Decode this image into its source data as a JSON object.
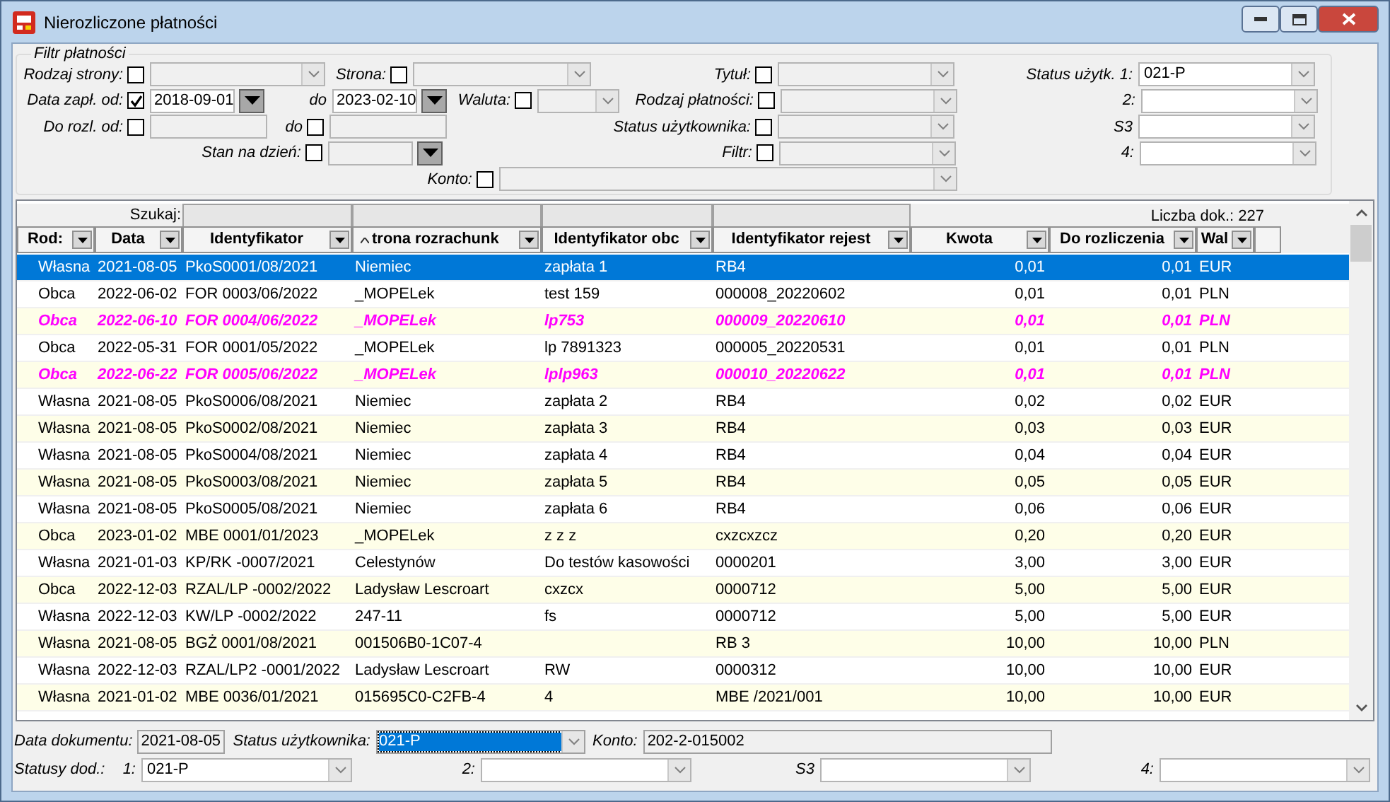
{
  "window": {
    "title": "Nierozliczone płatności"
  },
  "filter": {
    "title": "Filtr płatności",
    "fields": [
      {
        "label": "Rodzaj strony:",
        "kind": "combo",
        "checked": false
      },
      {
        "label": "Strona:",
        "kind": "combo",
        "checked": false
      },
      {
        "label": "Tytuł:",
        "kind": "combo",
        "checked": false
      },
      {
        "label": "Status użytk. 1:",
        "kind": "combo",
        "value": "021-P"
      },
      {
        "label": "Data zapł. od:",
        "kind": "date",
        "checked": true,
        "value": "2018-09-01"
      },
      {
        "label": "do",
        "kind": "date",
        "value": "2023-02-10"
      },
      {
        "label": "Waluta:",
        "kind": "combo",
        "checked": false
      },
      {
        "label": "Rodzaj płatności:",
        "kind": "combo",
        "checked": false
      },
      {
        "label": "2:",
        "kind": "combo"
      },
      {
        "label": "Do rozl. od:",
        "kind": "text",
        "checked": false
      },
      {
        "label": "do",
        "kind": "text",
        "checked": false
      },
      {
        "label": "Status użytkownika:",
        "kind": "combo",
        "checked": false
      },
      {
        "label": "S3",
        "kind": "combo"
      },
      {
        "label": "Stan na dzień:",
        "kind": "date",
        "checked": false
      },
      {
        "label": "Filtr:",
        "kind": "combo",
        "checked": false
      },
      {
        "label": "4:",
        "kind": "combo"
      },
      {
        "label": "Konto:",
        "kind": "combo",
        "checked": false
      }
    ]
  },
  "table": {
    "search_label": "Szukaj:",
    "count": "Liczba dok.: 227",
    "columns": [
      {
        "label": "Rod:",
        "searchable": false,
        "sorted": false
      },
      {
        "label": "Data",
        "searchable": false,
        "sorted": false
      },
      {
        "label": "Identyfikator",
        "searchable": true,
        "sorted": false
      },
      {
        "label": "trona rozrachunk",
        "searchable": true,
        "sorted": true
      },
      {
        "label": "Identyfikator obc",
        "searchable": true,
        "sorted": false
      },
      {
        "label": "Identyfikator rejest",
        "searchable": true,
        "sorted": false
      },
      {
        "label": "Kwota",
        "searchable": false,
        "sorted": false
      },
      {
        "label": "Do rozliczenia",
        "searchable": false,
        "sorted": false
      },
      {
        "label": "Wal",
        "searchable": false,
        "sorted": false
      }
    ],
    "rows": [
      {
        "selected": true,
        "flagged": false,
        "cells": [
          "Własna",
          "2021-08-05",
          "PkoS0001/08/2021",
          "Niemiec",
          "zapłata 1",
          "RB4",
          "0,01",
          "0,01",
          "EUR"
        ]
      },
      {
        "selected": false,
        "flagged": false,
        "cells": [
          "Obca",
          "2022-06-02",
          "FOR 0003/06/2022",
          "_MOPELek",
          "test 159",
          "000008_20220602",
          "0,01",
          "0,01",
          "PLN"
        ]
      },
      {
        "selected": false,
        "flagged": true,
        "cells": [
          "Obca",
          "2022-06-10",
          "FOR 0004/06/2022",
          "_MOPELek",
          "lp753",
          "000009_20220610",
          "0,01",
          "0,01",
          "PLN"
        ]
      },
      {
        "selected": false,
        "flagged": false,
        "cells": [
          "Obca",
          "2022-05-31",
          "FOR 0001/05/2022",
          "_MOPELek",
          "lp 7891323",
          "000005_20220531",
          "0,01",
          "0,01",
          "PLN"
        ]
      },
      {
        "selected": false,
        "flagged": true,
        "cells": [
          "Obca",
          "2022-06-22",
          "FOR 0005/06/2022",
          "_MOPELek",
          "lplp963",
          "000010_20220622",
          "0,01",
          "0,01",
          "PLN"
        ]
      },
      {
        "selected": false,
        "flagged": false,
        "cells": [
          "Własna",
          "2021-08-05",
          "PkoS0006/08/2021",
          "Niemiec",
          "zapłata 2",
          "RB4",
          "0,02",
          "0,02",
          "EUR"
        ]
      },
      {
        "selected": false,
        "flagged": false,
        "cells": [
          "Własna",
          "2021-08-05",
          "PkoS0002/08/2021",
          "Niemiec",
          "zapłata 3",
          "RB4",
          "0,03",
          "0,03",
          "EUR"
        ]
      },
      {
        "selected": false,
        "flagged": false,
        "cells": [
          "Własna",
          "2021-08-05",
          "PkoS0004/08/2021",
          "Niemiec",
          "zapłata 4",
          "RB4",
          "0,04",
          "0,04",
          "EUR"
        ]
      },
      {
        "selected": false,
        "flagged": false,
        "cells": [
          "Własna",
          "2021-08-05",
          "PkoS0003/08/2021",
          "Niemiec",
          "zapłata 5",
          "RB4",
          "0,05",
          "0,05",
          "EUR"
        ]
      },
      {
        "selected": false,
        "flagged": false,
        "cells": [
          "Własna",
          "2021-08-05",
          "PkoS0005/08/2021",
          "Niemiec",
          "zapłata 6",
          "RB4",
          "0,06",
          "0,06",
          "EUR"
        ]
      },
      {
        "selected": false,
        "flagged": false,
        "cells": [
          "Obca",
          "2023-01-02",
          "MBE 0001/01/2023",
          "_MOPELek",
          "z z z",
          "cxzcxzcz",
          "0,20",
          "0,20",
          "EUR"
        ]
      },
      {
        "selected": false,
        "flagged": false,
        "cells": [
          "Własna",
          "2021-01-03",
          "KP/RK -0007/2021",
          "Celestynów",
          "Do testów kasowości",
          "0000201",
          "3,00",
          "3,00",
          "EUR"
        ]
      },
      {
        "selected": false,
        "flagged": false,
        "cells": [
          "Obca",
          "2022-12-03",
          "RZAL/LP -0002/2022",
          "Ladysław Lescroart",
          "cxzcx",
          "0000712",
          "5,00",
          "5,00",
          "EUR"
        ]
      },
      {
        "selected": false,
        "flagged": false,
        "cells": [
          "Własna",
          "2022-12-03",
          "KW/LP -0002/2022",
          "247-11",
          "fs",
          "0000712",
          "5,00",
          "5,00",
          "EUR"
        ]
      },
      {
        "selected": false,
        "flagged": false,
        "cells": [
          "Własna",
          "2021-08-05",
          "BGŻ 0001/08/2021",
          "001506B0-1C07-4",
          null,
          "RB 3",
          "10,00",
          "10,00",
          "PLN"
        ]
      },
      {
        "selected": false,
        "flagged": false,
        "cells": [
          "Własna",
          "2022-12-03",
          "RZAL/LP2 -0001/2022",
          "Ladysław Lescroart",
          "RW",
          "0000312",
          "10,00",
          "10,00",
          "EUR"
        ]
      },
      {
        "selected": false,
        "flagged": false,
        "cells": [
          "Własna",
          "2021-01-02",
          "MBE 0036/01/2021",
          "015695C0-C2FB-4",
          "4",
          "MBE /2021/001",
          "10,00",
          "10,00",
          "EUR"
        ]
      }
    ]
  },
  "details": {
    "document_date": {
      "label": "Data dokumentu:",
      "value": "2021-08-05"
    },
    "user_status": {
      "label": "Status użytkownika:",
      "value": "021-P",
      "focused": true
    },
    "account": {
      "label": "Konto:",
      "value": "202-2-015002"
    },
    "extra_statuses": {
      "label": "Statusy dod.:",
      "items": [
        {
          "label": "1:",
          "value": "021-P"
        },
        {
          "label": "2:"
        },
        {
          "label": "S3"
        },
        {
          "label": "4:"
        }
      ]
    }
  }
}
